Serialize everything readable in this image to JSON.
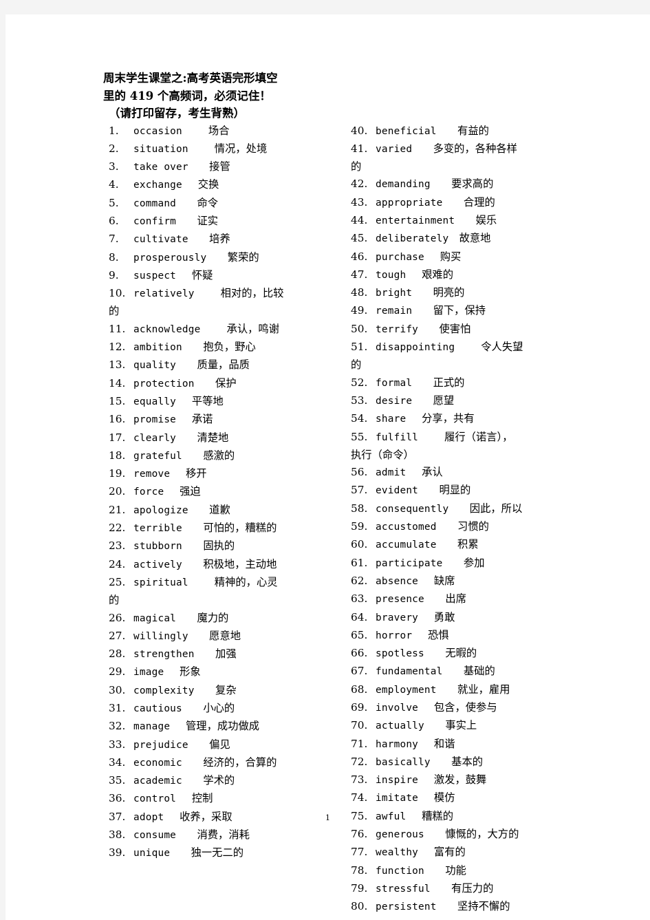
{
  "document": {
    "title_lines": [
      "周末学生课堂之:高考英语完形填空",
      "里的 419 个高频词，必须记住！",
      "（请打印留存，考生背熟）"
    ],
    "page_number": "1",
    "columns": {
      "left": [
        {
          "num": "1.",
          "word": "occasion",
          "gap": 5,
          "cn": "场合"
        },
        {
          "num": "2.",
          "word": "situation",
          "gap": 5,
          "cn": "情况，处境"
        },
        {
          "num": "3.",
          "word": "take  over",
          "gap": 4,
          "cn": "接管"
        },
        {
          "num": "4.",
          "word": "exchange",
          "gap": 3,
          "cn": "交换"
        },
        {
          "num": "5.",
          "word": "command",
          "gap": 4,
          "cn": "命令"
        },
        {
          "num": "6.",
          "word": "confirm",
          "gap": 4,
          "cn": "证实"
        },
        {
          "num": "7.",
          "word": "cultivate",
          "gap": 4,
          "cn": "培养"
        },
        {
          "num": "8.",
          "word": "prosperously",
          "gap": 4,
          "cn": "繁荣的"
        },
        {
          "num": "9.",
          "word": "suspect",
          "gap": 3,
          "cn": "怀疑"
        },
        {
          "num": "10.",
          "word": "relatively",
          "gap": 5,
          "cn": "相对的，比较",
          "wrap": "的"
        },
        {
          "num": "11.",
          "word": "acknowledge",
          "gap": 5,
          "cn": "承认，鸣谢"
        },
        {
          "num": "12.",
          "word": "ambition",
          "gap": 4,
          "cn": "抱负，野心"
        },
        {
          "num": "13.",
          "word": "quality",
          "gap": 4,
          "cn": "质量，品质"
        },
        {
          "num": "14.",
          "word": "protection",
          "gap": 4,
          "cn": "保护"
        },
        {
          "num": "15.",
          "word": "equally",
          "gap": 3,
          "cn": "平等地"
        },
        {
          "num": "16.",
          "word": "promise",
          "gap": 3,
          "cn": "承诺"
        },
        {
          "num": "17.",
          "word": "clearly",
          "gap": 4,
          "cn": "清楚地"
        },
        {
          "num": "18.",
          "word": "grateful",
          "gap": 4,
          "cn": "感激的"
        },
        {
          "num": "19.",
          "word": "remove",
          "gap": 3,
          "cn": "移开"
        },
        {
          "num": "20.",
          "word": "force",
          "gap": 3,
          "cn": "强迫"
        },
        {
          "num": "21.",
          "word": "apologize",
          "gap": 4,
          "cn": "道歉"
        },
        {
          "num": "22.",
          "word": "terrible",
          "gap": 4,
          "cn": "可怕的，糟糕的"
        },
        {
          "num": "23.",
          "word": "stubborn",
          "gap": 4,
          "cn": "固执的"
        },
        {
          "num": "24.",
          "word": "actively",
          "gap": 4,
          "cn": "积极地，主动地"
        },
        {
          "num": "25.",
          "word": "spiritual",
          "gap": 5,
          "cn": "精神的，心灵",
          "wrap": "的"
        },
        {
          "num": "26.",
          "word": "magical",
          "gap": 4,
          "cn": "魔力的"
        },
        {
          "num": "27.",
          "word": "willingly",
          "gap": 4,
          "cn": "愿意地"
        },
        {
          "num": "28.",
          "word": "strengthen",
          "gap": 4,
          "cn": "加强"
        },
        {
          "num": "29.",
          "word": "image",
          "gap": 3,
          "cn": "形象"
        },
        {
          "num": "30.",
          "word": "complexity",
          "gap": 4,
          "cn": "复杂"
        },
        {
          "num": "31.",
          "word": "cautious",
          "gap": 4,
          "cn": "小心的"
        },
        {
          "num": "32.",
          "word": "manage",
          "gap": 3,
          "cn": "管理，成功做成"
        },
        {
          "num": "33.",
          "word": "prejudice",
          "gap": 4,
          "cn": "偏见"
        },
        {
          "num": "34.",
          "word": "economic",
          "gap": 4,
          "cn": "经济的，合算的"
        },
        {
          "num": "35.",
          "word": "academic",
          "gap": 4,
          "cn": "学术的"
        },
        {
          "num": "36.",
          "word": "control",
          "gap": 3,
          "cn": "控制"
        },
        {
          "num": "37.",
          "word": "adopt",
          "gap": 3,
          "cn": "收养，采取"
        },
        {
          "num": "38.",
          "word": "consume",
          "gap": 4,
          "cn": "消费，消耗"
        },
        {
          "num": "39.",
          "word": "unique",
          "gap": 4,
          "cn": "独一无二的"
        }
      ],
      "right": [
        {
          "num": "40.",
          "word": "beneficial",
          "gap": 4,
          "cn": "有益的"
        },
        {
          "num": "41.",
          "word": "varied",
          "gap": 4,
          "cn": "多变的，各种各样",
          "wrap": "的"
        },
        {
          "num": "42.",
          "word": "demanding",
          "gap": 4,
          "cn": "要求高的"
        },
        {
          "num": "43.",
          "word": "appropriate",
          "gap": 4,
          "cn": "合理的"
        },
        {
          "num": "44.",
          "word": "entertainment",
          "gap": 4,
          "cn": "娱乐"
        },
        {
          "num": "45.",
          "word": "deliberately",
          "gap": 2,
          "cn": "故意地"
        },
        {
          "num": "46.",
          "word": "purchase",
          "gap": 3,
          "cn": "购买"
        },
        {
          "num": "47.",
          "word": "tough",
          "gap": 3,
          "cn": "艰难的"
        },
        {
          "num": "48.",
          "word": "bright",
          "gap": 4,
          "cn": "明亮的"
        },
        {
          "num": "49.",
          "word": "remain",
          "gap": 4,
          "cn": "留下，保持"
        },
        {
          "num": "50.",
          "word": "terrify",
          "gap": 4,
          "cn": "使害怕"
        },
        {
          "num": "51.",
          "word": "disappointing",
          "gap": 5,
          "cn": "令人失望",
          "wrap": "的"
        },
        {
          "num": "52.",
          "word": "formal",
          "gap": 4,
          "cn": "正式的"
        },
        {
          "num": "53.",
          "word": "desire",
          "gap": 4,
          "cn": "愿望"
        },
        {
          "num": "54.",
          "word": "share",
          "gap": 3,
          "cn": "分享，共有"
        },
        {
          "num": "55.",
          "word": "fulfill",
          "gap": 5,
          "cn": "履行（诺言），",
          "wrap": "执行（命令）"
        },
        {
          "num": "56.",
          "word": "admit",
          "gap": 3,
          "cn": "承认"
        },
        {
          "num": "57.",
          "word": "evident",
          "gap": 4,
          "cn": "明显的"
        },
        {
          "num": "58.",
          "word": "consequently",
          "gap": 4,
          "cn": "因此，所以"
        },
        {
          "num": "59.",
          "word": "accustomed",
          "gap": 4,
          "cn": "习惯的"
        },
        {
          "num": "60.",
          "word": "accumulate",
          "gap": 4,
          "cn": "积累"
        },
        {
          "num": "61.",
          "word": "participate",
          "gap": 4,
          "cn": "参加"
        },
        {
          "num": "62.",
          "word": "absence",
          "gap": 3,
          "cn": "缺席"
        },
        {
          "num": "63.",
          "word": "presence",
          "gap": 4,
          "cn": "出席"
        },
        {
          "num": "64.",
          "word": "bravery",
          "gap": 3,
          "cn": "勇敢"
        },
        {
          "num": "65.",
          "word": "horror",
          "gap": 3,
          "cn": "恐惧"
        },
        {
          "num": "66.",
          "word": "spotless",
          "gap": 4,
          "cn": "无暇的"
        },
        {
          "num": "67.",
          "word": "fundamental",
          "gap": 4,
          "cn": "基础的"
        },
        {
          "num": "68.",
          "word": "employment",
          "gap": 4,
          "cn": "就业，雇用"
        },
        {
          "num": "69.",
          "word": "involve",
          "gap": 3,
          "cn": "包含，使参与"
        },
        {
          "num": "70.",
          "word": "actually",
          "gap": 4,
          "cn": "事实上"
        },
        {
          "num": "71.",
          "word": "harmony",
          "gap": 3,
          "cn": "和谐"
        },
        {
          "num": "72.",
          "word": "basically",
          "gap": 4,
          "cn": "基本的"
        },
        {
          "num": "73.",
          "word": "inspire",
          "gap": 3,
          "cn": "激发，鼓舞"
        },
        {
          "num": "74.",
          "word": "imitate",
          "gap": 3,
          "cn": "模仿"
        },
        {
          "num": "75.",
          "word": "awful",
          "gap": 3,
          "cn": "糟糕的"
        },
        {
          "num": "76.",
          "word": "generous",
          "gap": 4,
          "cn": "慷慨的，大方的"
        },
        {
          "num": "77.",
          "word": "wealthy",
          "gap": 3,
          "cn": "富有的"
        },
        {
          "num": "78.",
          "word": "function",
          "gap": 4,
          "cn": "功能"
        },
        {
          "num": "79.",
          "word": "stressful",
          "gap": 4,
          "cn": "有压力的"
        },
        {
          "num": "80.",
          "word": "persistent",
          "gap": 4,
          "cn": "坚持不懈的"
        }
      ]
    }
  }
}
